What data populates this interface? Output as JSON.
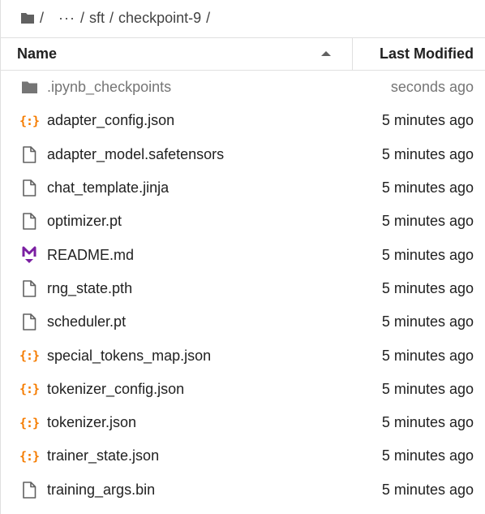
{
  "breadcrumb": {
    "root_sep": "/",
    "ellipsis": "···",
    "sep1": "/",
    "folder1": "sft",
    "sep2": "/",
    "folder2": "checkpoint-9",
    "sep3": "/"
  },
  "header": {
    "name_label": "Name",
    "modified_label": "Last Modified",
    "sort": "ascending"
  },
  "files": [
    {
      "name": ".ipynb_checkpoints",
      "modified": "seconds ago",
      "icon": "folder-icon",
      "dim": true
    },
    {
      "name": "adapter_config.json",
      "modified": "5 minutes ago",
      "icon": "json-icon"
    },
    {
      "name": "adapter_model.safetensors",
      "modified": "5 minutes ago",
      "icon": "file-icon"
    },
    {
      "name": "chat_template.jinja",
      "modified": "5 minutes ago",
      "icon": "file-icon"
    },
    {
      "name": "optimizer.pt",
      "modified": "5 minutes ago",
      "icon": "file-icon"
    },
    {
      "name": "README.md",
      "modified": "5 minutes ago",
      "icon": "markdown-icon"
    },
    {
      "name": "rng_state.pth",
      "modified": "5 minutes ago",
      "icon": "file-icon"
    },
    {
      "name": "scheduler.pt",
      "modified": "5 minutes ago",
      "icon": "file-icon"
    },
    {
      "name": "special_tokens_map.json",
      "modified": "5 minutes ago",
      "icon": "json-icon"
    },
    {
      "name": "tokenizer_config.json",
      "modified": "5 minutes ago",
      "icon": "json-icon"
    },
    {
      "name": "tokenizer.json",
      "modified": "5 minutes ago",
      "icon": "json-icon"
    },
    {
      "name": "trainer_state.json",
      "modified": "5 minutes ago",
      "icon": "json-icon"
    },
    {
      "name": "training_args.bin",
      "modified": "5 minutes ago",
      "icon": "file-icon"
    }
  ],
  "colors": {
    "json_icon": "#f57c00",
    "markdown_icon": "#7b1fa2",
    "folder_icon": "#616161",
    "file_icon": "#616161"
  }
}
